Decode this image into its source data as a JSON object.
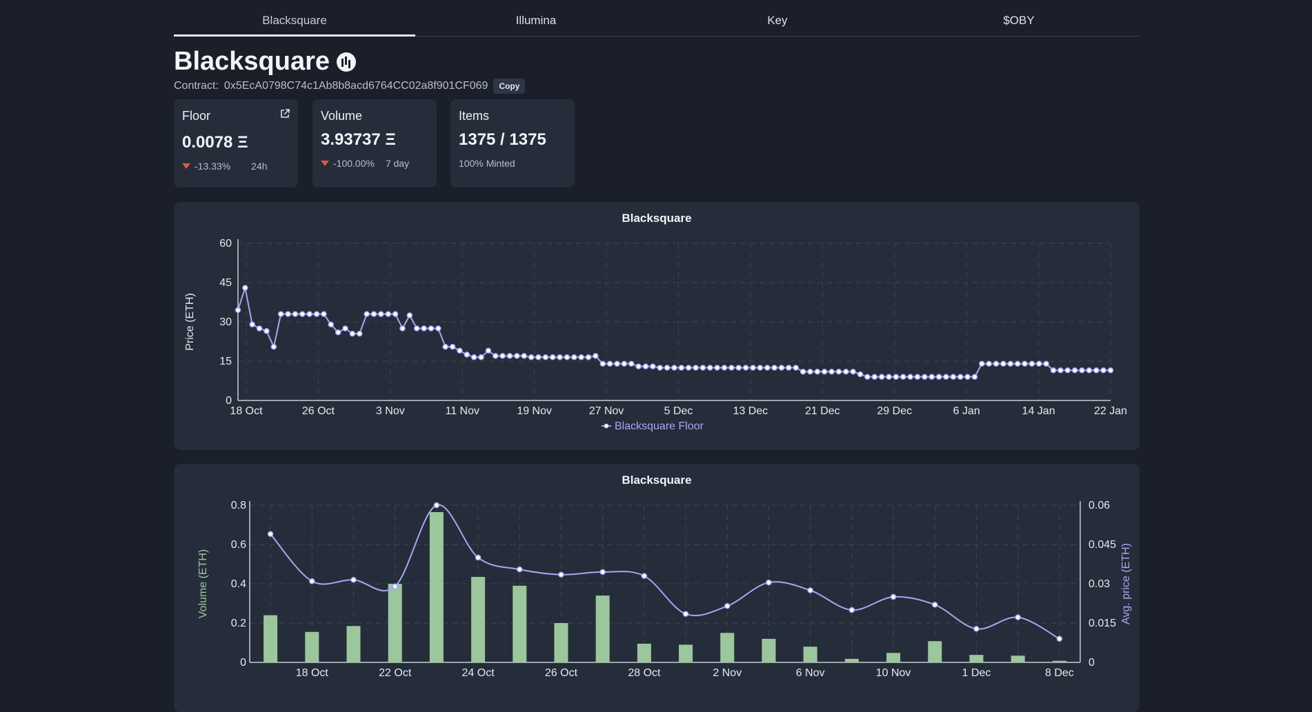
{
  "tabs": [
    "Blacksquare",
    "Illumina",
    "Key",
    "$OBY"
  ],
  "collection": {
    "name": "Blacksquare",
    "contract_label": "Contract:",
    "contract_address": "0x5EcA0798C74c1Ab8b8acd6764CC02a8f901CF069",
    "copy_label": "Copy"
  },
  "stats": {
    "floor": {
      "label": "Floor",
      "value": "0.0078 Ξ",
      "change": "-13.33%",
      "period": "24h"
    },
    "volume": {
      "label": "Volume",
      "value": "3.93737 Ξ",
      "change": "-100.00%",
      "period": "7 day"
    },
    "items": {
      "label": "Items",
      "value": "1375 / 1375",
      "sub": "100% Minted"
    }
  },
  "colors": {
    "line": "#a9a6f5",
    "bar": "#9cc79d",
    "down": "#e0574a"
  },
  "chart_data": [
    {
      "type": "line",
      "title": "Blacksquare",
      "ylabel": "Price (ETH)",
      "xlabel": "",
      "ylim": [
        0,
        60
      ],
      "yticks": [
        0,
        15,
        30,
        45,
        60
      ],
      "xticks": [
        "18 Oct",
        "26 Oct",
        "3 Nov",
        "11 Nov",
        "19 Nov",
        "27 Nov",
        "5 Dec",
        "13 Dec",
        "21 Dec",
        "29 Dec",
        "6 Jan",
        "14 Jan",
        "22 Jan"
      ],
      "grid": true,
      "legend": "bottom-center",
      "series": [
        {
          "name": "Blacksquare Floor",
          "values": [
            34.5,
            43,
            29,
            27.5,
            26.5,
            20.5,
            33,
            33,
            33,
            33,
            33,
            33,
            33,
            29,
            26,
            27.5,
            25.5,
            25.5,
            33,
            33,
            33,
            33,
            33,
            27.5,
            32.5,
            27.5,
            27.5,
            27.5,
            27.5,
            20.5,
            20.5,
            19,
            17.5,
            16.5,
            16.5,
            19,
            17,
            17,
            17,
            17,
            17,
            16.5,
            16.5,
            16.5,
            16.5,
            16.5,
            16.5,
            16.5,
            16.5,
            16.5,
            17,
            14,
            14,
            14,
            14,
            14,
            13,
            13,
            13,
            12.5,
            12.5,
            12.5,
            12.5,
            12.5,
            12.5,
            12.5,
            12.5,
            12.5,
            12.5,
            12.5,
            12.5,
            12.5,
            12.5,
            12.5,
            12.5,
            12.5,
            12.5,
            12.5,
            12.5,
            11,
            11,
            11,
            11,
            11,
            11,
            11,
            11,
            10,
            9,
            9,
            9,
            9,
            9,
            9,
            9,
            9,
            9,
            9,
            9,
            9,
            9,
            9,
            9,
            9,
            14,
            14,
            14,
            14,
            14,
            14,
            14,
            14,
            14,
            14,
            11.5,
            11.5,
            11.5,
            11.5,
            11.5,
            11.5,
            11.5,
            11.5,
            11.5
          ]
        }
      ]
    },
    {
      "type": "bar",
      "title": "Blacksquare",
      "ylabel": "Volume (ETH)",
      "y2label": "Avg. price (ETH)",
      "ylim": [
        0,
        0.8
      ],
      "yticks": [
        0,
        0.2,
        0.4,
        0.6,
        0.8
      ],
      "y2lim": [
        0,
        0.06
      ],
      "y2ticks": [
        0,
        0.015,
        0.03,
        0.045,
        0.06
      ],
      "xticks": [
        "18 Oct",
        "22 Oct",
        "24 Oct",
        "26 Oct",
        "28 Oct",
        "2 Nov",
        "6 Nov",
        "10 Nov",
        "1 Dec",
        "8 Dec"
      ],
      "grid": true,
      "series": [
        {
          "kind": "bar",
          "values": [
            0.24,
            0.155,
            0.185,
            0.4,
            0.765,
            0.435,
            0.39,
            0.2,
            0.34,
            0.095,
            0.09,
            0.15,
            0.12,
            0.08,
            0.018,
            0.048,
            0.108,
            0.038,
            0.034,
            0.008
          ]
        },
        {
          "kind": "line",
          "values": [
            0.049,
            0.031,
            0.0315,
            0.029,
            0.06,
            0.04,
            0.0355,
            0.0335,
            0.0345,
            0.033,
            0.0185,
            0.0215,
            0.0305,
            0.0275,
            0.02,
            0.025,
            0.022,
            0.0128,
            0.0172,
            0.009
          ]
        }
      ]
    }
  ]
}
